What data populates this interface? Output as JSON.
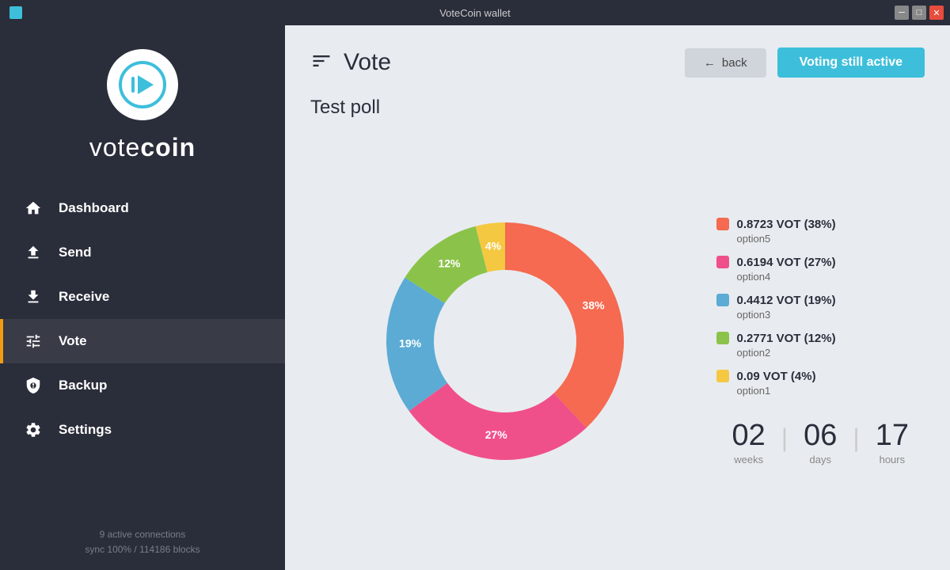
{
  "titlebar": {
    "title": "VoteCoin wallet",
    "minimize_label": "─",
    "maximize_label": "□",
    "close_label": "✕"
  },
  "sidebar": {
    "brand_light": "vote",
    "brand_bold": "coin",
    "nav_items": [
      {
        "id": "dashboard",
        "label": "Dashboard",
        "icon": "home"
      },
      {
        "id": "send",
        "label": "Send",
        "icon": "upload"
      },
      {
        "id": "receive",
        "label": "Receive",
        "icon": "download"
      },
      {
        "id": "vote",
        "label": "Vote",
        "icon": "sliders",
        "active": true
      },
      {
        "id": "backup",
        "label": "Backup",
        "icon": "shield"
      },
      {
        "id": "settings",
        "label": "Settings",
        "icon": "gear"
      }
    ],
    "footer": {
      "connections": "9 active connections",
      "sync": "sync 100% / 114186 blocks"
    }
  },
  "main": {
    "page_title": "Vote",
    "back_label": "back",
    "voting_active_label": "Voting still active",
    "poll_title": "Test poll",
    "chart": {
      "segments": [
        {
          "label": "option5",
          "value": "0.8723 VOT (38%)",
          "percent": 38,
          "color": "#f56a50",
          "text_percent": "38%"
        },
        {
          "label": "option4",
          "value": "0.6194 VOT (27%)",
          "percent": 27,
          "color": "#f0508a",
          "text_percent": "27%"
        },
        {
          "label": "option3",
          "value": "0.4412 VOT (19%)",
          "percent": 19,
          "color": "#5babd4",
          "text_percent": "19%"
        },
        {
          "label": "option2",
          "value": "0.2771 VOT (12%)",
          "percent": 12,
          "color": "#8bc34a",
          "text_percent": "12%"
        },
        {
          "label": "option1",
          "value": "0.09 VOT (4%)",
          "percent": 4,
          "color": "#f5c842",
          "text_percent": "4%"
        }
      ]
    },
    "timer": {
      "weeks": "02",
      "days": "06",
      "hours": "17",
      "weeks_label": "weeks",
      "days_label": "days",
      "hours_label": "hours"
    }
  }
}
